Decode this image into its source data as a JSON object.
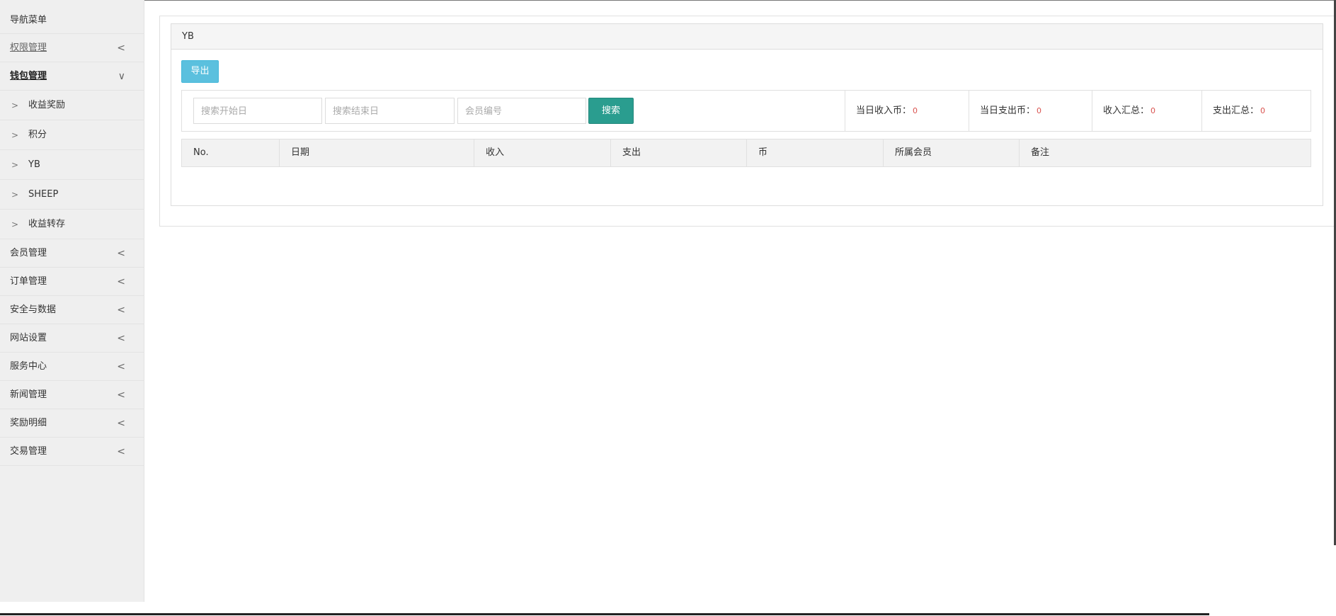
{
  "sidebar": {
    "title": "导航菜单",
    "items": [
      {
        "label": "权限管理",
        "chevron": "<"
      },
      {
        "label": "钱包管理",
        "chevron": "∨"
      },
      {
        "label": "会员管理",
        "chevron": "<"
      },
      {
        "label": "订单管理",
        "chevron": "<"
      },
      {
        "label": "安全与数据",
        "chevron": "<"
      },
      {
        "label": "网站设置",
        "chevron": "<"
      },
      {
        "label": "服务中心",
        "chevron": "<"
      },
      {
        "label": "新闻管理",
        "chevron": "<"
      },
      {
        "label": "奖励明细",
        "chevron": "<"
      },
      {
        "label": "交易管理",
        "chevron": "<"
      }
    ],
    "sub_items": [
      {
        "label": "收益奖励",
        "caret": ">"
      },
      {
        "label": "积分",
        "caret": ">"
      },
      {
        "label": "YB",
        "caret": ">"
      },
      {
        "label": "SHEEP",
        "caret": ">"
      },
      {
        "label": "收益转存",
        "caret": ">"
      }
    ]
  },
  "panel": {
    "heading": "YB"
  },
  "toolbar": {
    "export_label": "导出",
    "search_label": "搜索"
  },
  "search": {
    "start_placeholder": "搜索开始日",
    "end_placeholder": "搜索结束日",
    "member_placeholder": "会员编号"
  },
  "stats": [
    {
      "label": "当日收入币：",
      "value": "0"
    },
    {
      "label": "当日支出币：",
      "value": "0"
    },
    {
      "label": "收入汇总：",
      "value": "0"
    },
    {
      "label": "支出汇总：",
      "value": "0"
    }
  ],
  "table": {
    "columns": [
      "No.",
      "日期",
      "收入",
      "支出",
      "币",
      "所属会员",
      "备注"
    ]
  },
  "colors": {
    "export_button": "#5bc0de",
    "search_button": "#2a9d8f",
    "stat_value": "#d9534f",
    "sidebar_bg": "#efefef"
  },
  "icons": {
    "collapsed": "chevron-left-icon",
    "expanded": "chevron-down-icon",
    "sub_item": "chevron-right-icon"
  }
}
